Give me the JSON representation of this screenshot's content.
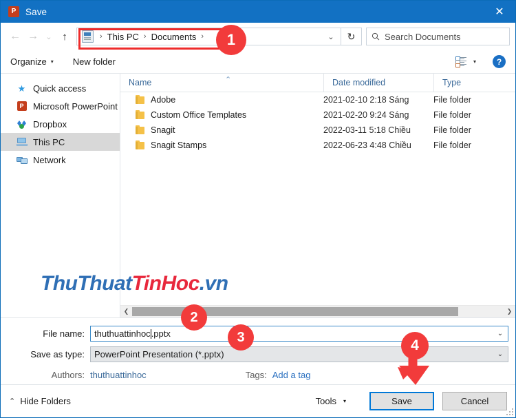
{
  "window": {
    "title": "Save",
    "app_icon": "powerpoint-icon",
    "app_icon_letter": "P",
    "close_label": "✕"
  },
  "address_bar": {
    "back_icon": "←",
    "forward_icon": "→",
    "recent_icon": "⌄",
    "up_icon": "↑",
    "breadcrumbs": [
      "This PC",
      "Documents"
    ],
    "separator": "›",
    "dropdown_icon": "⌄",
    "refresh_icon": "↻",
    "search_placeholder": "Search Documents",
    "search_value": "",
    "search_icon": "search-icon"
  },
  "toolbar": {
    "organize_label": "Organize",
    "organize_caret": "▾",
    "new_folder_label": "New folder",
    "view_caret": "▾",
    "help_label": "?"
  },
  "sidebar": {
    "items": [
      {
        "label": "Quick access",
        "icon": "star-icon",
        "selected": false
      },
      {
        "label": "Microsoft PowerPoint",
        "icon": "powerpoint-icon",
        "selected": false
      },
      {
        "label": "Dropbox",
        "icon": "dropbox-icon",
        "selected": false
      },
      {
        "label": "This PC",
        "icon": "this-pc-icon",
        "selected": true
      },
      {
        "label": "Network",
        "icon": "network-icon",
        "selected": false
      }
    ]
  },
  "file_list": {
    "columns": [
      "Name",
      "Date modified",
      "Type"
    ],
    "sort_indicator": "⌃",
    "rows": [
      {
        "name": "Adobe",
        "date": "2021-02-10 2:18 Sáng",
        "type": "File folder"
      },
      {
        "name": "Custom Office Templates",
        "date": "2021-02-20 9:24 Sáng",
        "type": "File folder"
      },
      {
        "name": "Snagit",
        "date": "2022-03-11 5:18 Chiều",
        "type": "File folder"
      },
      {
        "name": "Snagit Stamps",
        "date": "2022-06-23 4:48 Chiều",
        "type": "File folder"
      }
    ],
    "scroll_left_icon": "❮",
    "scroll_right_icon": "❯"
  },
  "watermark": {
    "part1": "ThuThuat",
    "part2": "TinHoc",
    "part3": ".vn",
    "color_blue": "#2f6fb5",
    "color_red": "#e8283c"
  },
  "form": {
    "file_name_label": "File name:",
    "file_name_value": "thuthuattinhoc",
    "file_name_value_tail": ".pptx",
    "save_as_type_label": "Save as type:",
    "save_as_type_value": "PowerPoint Presentation (*.pptx)",
    "dropdown_icon": "⌄",
    "authors_label": "Authors:",
    "authors_value": "thuthuattinhoc",
    "tags_label": "Tags:",
    "tags_value": "Add a tag"
  },
  "footer": {
    "hide_folders_label": "Hide Folders",
    "hide_folders_chevron": "⌃",
    "tools_label": "Tools",
    "tools_caret": "▾",
    "save_label": "Save",
    "cancel_label": "Cancel"
  },
  "annotations": {
    "accent_color": "#f23b3b",
    "badges": [
      {
        "number": "1"
      },
      {
        "number": "2"
      },
      {
        "number": "3"
      },
      {
        "number": "4"
      }
    ]
  }
}
